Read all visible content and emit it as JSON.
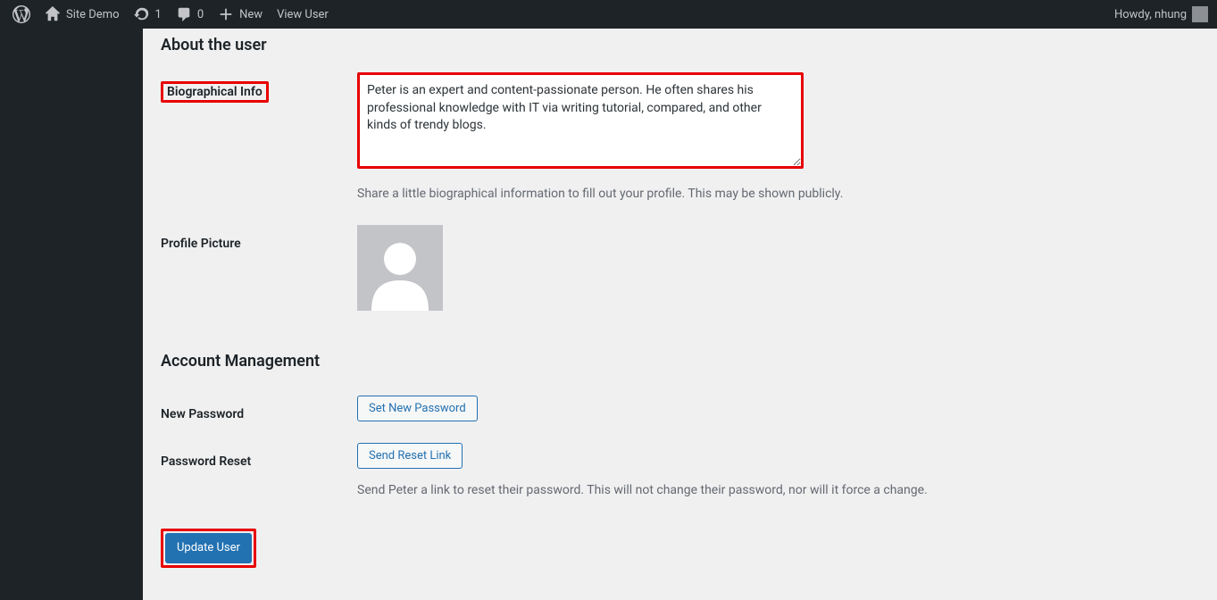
{
  "adminbar": {
    "site_name": "Site Demo",
    "updates_count": "1",
    "comments_count": "0",
    "new_label": "New",
    "view_user_label": "View User",
    "howdy_text": "Howdy, nhung"
  },
  "about_section": {
    "heading": "About the user",
    "bio_label": "Biographical Info",
    "bio_value": "Peter is an expert and content-passionate person. He often shares his professional knowledge with IT via writing tutorial, compared, and other kinds of trendy blogs.",
    "bio_description": "Share a little biographical information to fill out your profile. This may be shown publicly.",
    "picture_label": "Profile Picture"
  },
  "account_section": {
    "heading": "Account Management",
    "new_password_label": "New Password",
    "set_password_button": "Set New Password",
    "password_reset_label": "Password Reset",
    "send_reset_button": "Send Reset Link",
    "reset_description": "Send Peter a link to reset their password. This will not change their password, nor will it force a change."
  },
  "submit": {
    "update_button": "Update User"
  }
}
